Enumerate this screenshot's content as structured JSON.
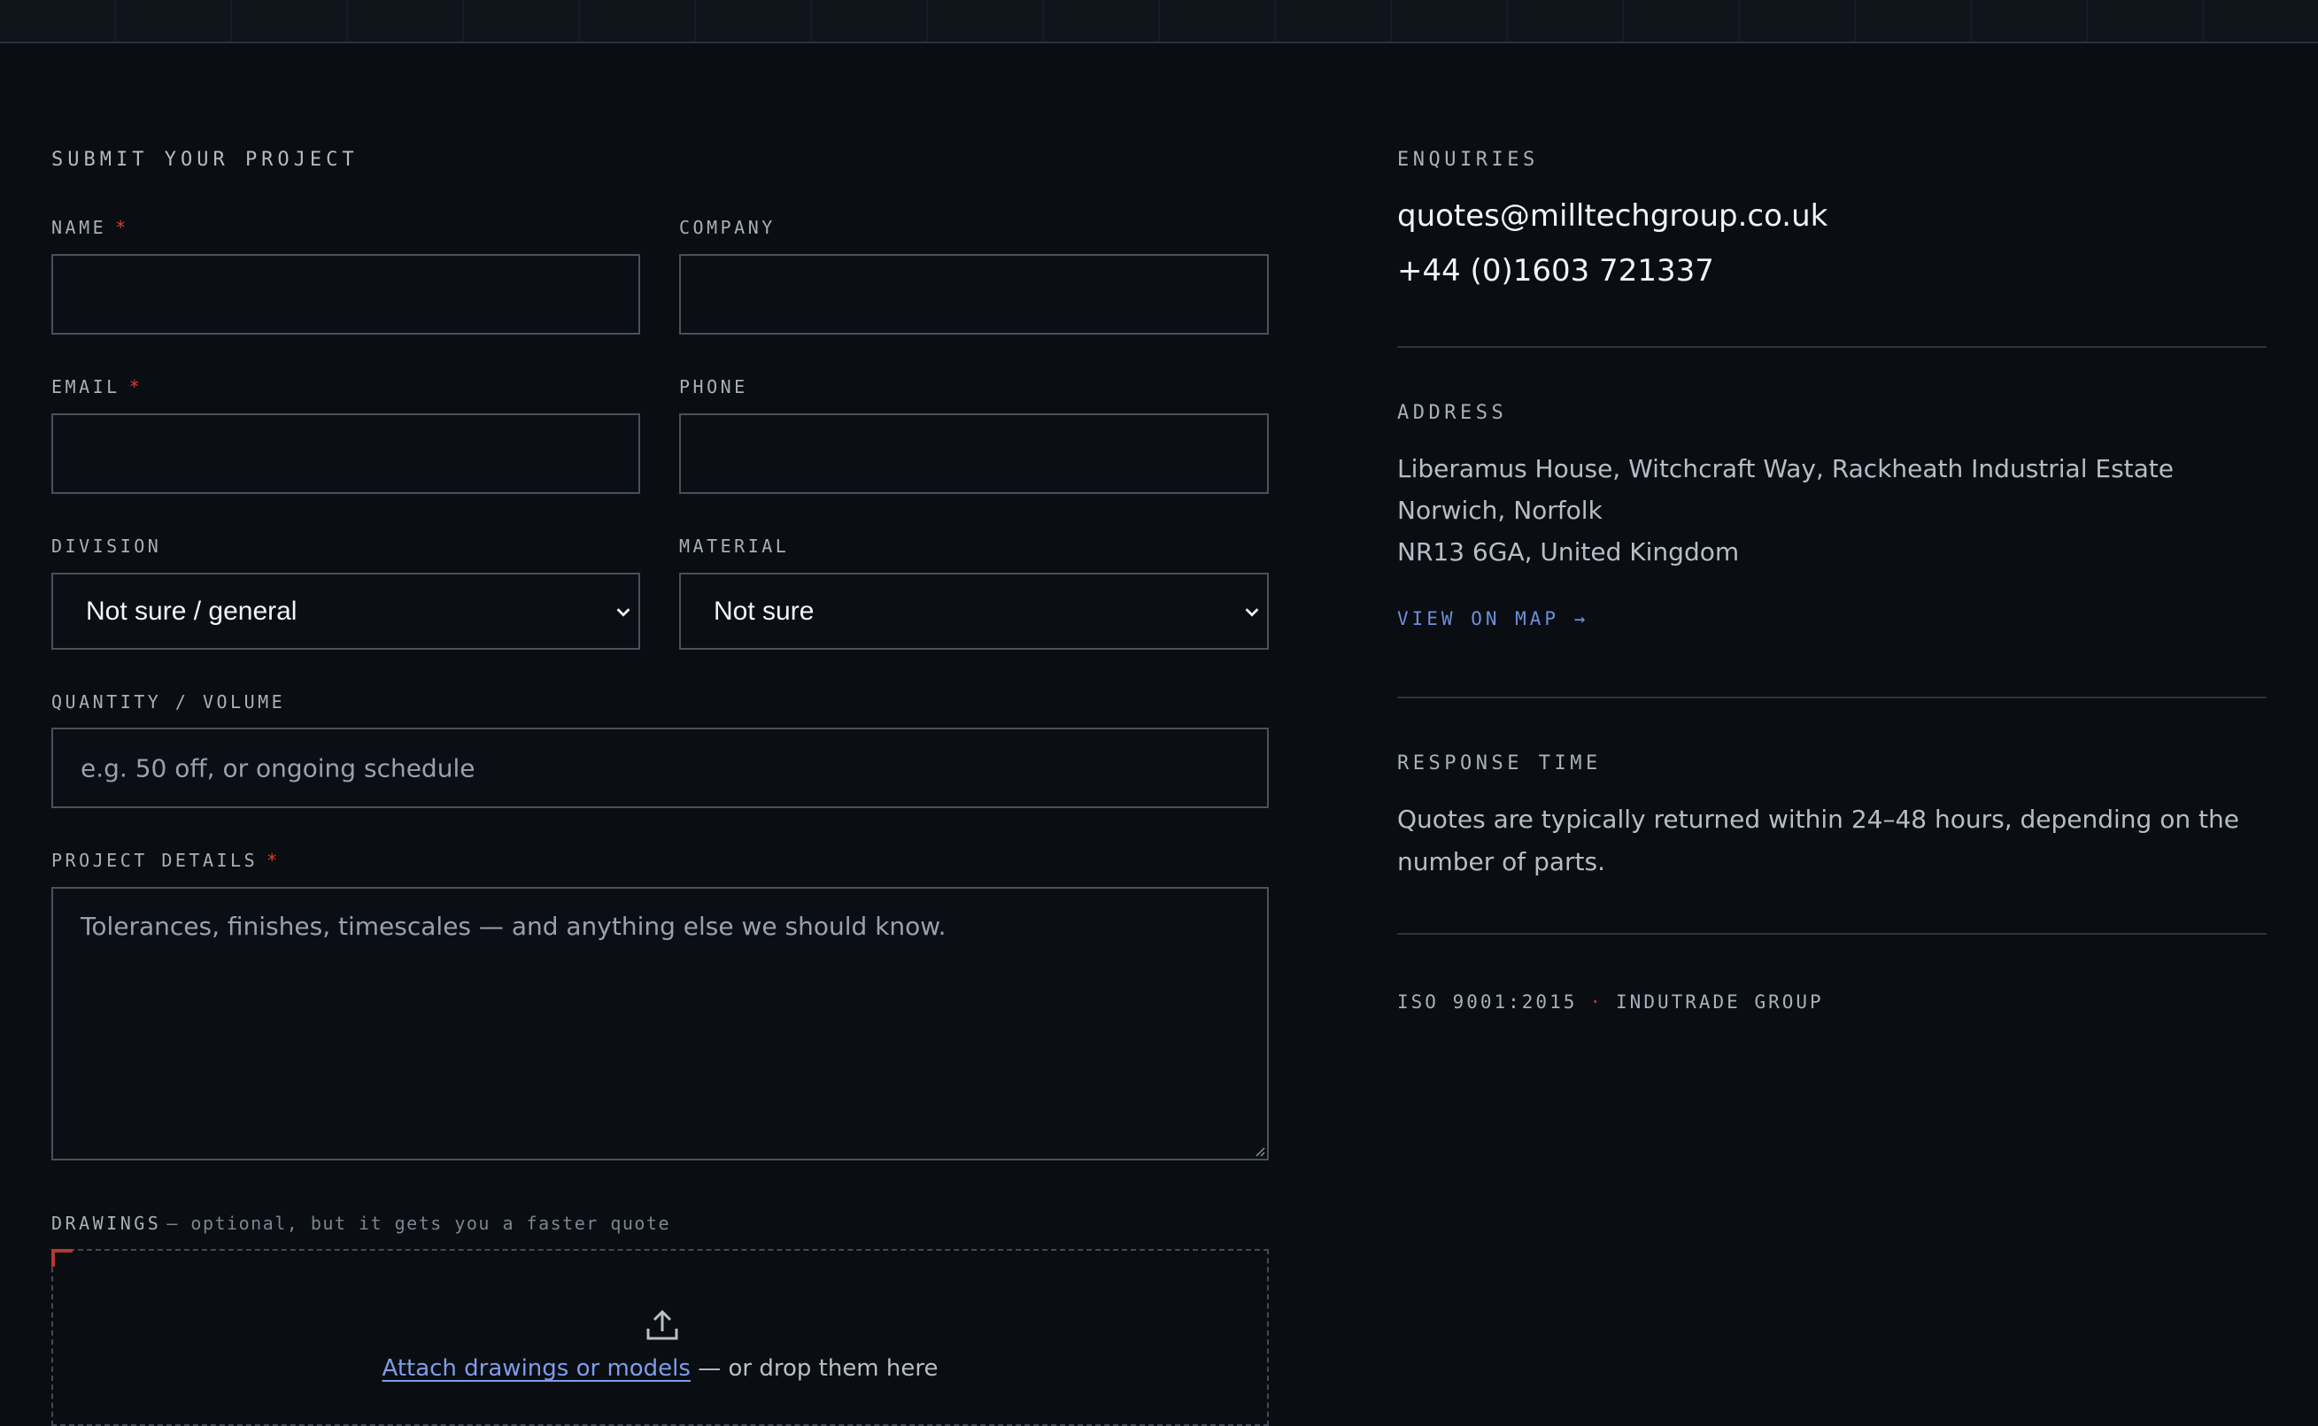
{
  "form": {
    "title": "SUBMIT YOUR PROJECT",
    "required_marker": "*",
    "fields": {
      "name": {
        "label": "NAME",
        "value": ""
      },
      "company": {
        "label": "COMPANY",
        "value": ""
      },
      "email": {
        "label": "EMAIL",
        "value": ""
      },
      "phone": {
        "label": "PHONE",
        "value": ""
      },
      "division": {
        "label": "DIVISION",
        "selected": "Not sure / general"
      },
      "material": {
        "label": "MATERIAL",
        "selected": "Not sure"
      },
      "quantity": {
        "label": "QUANTITY / VOLUME",
        "placeholder": "e.g. 50 off, or ongoing schedule"
      },
      "details": {
        "label": "PROJECT DETAILS",
        "placeholder": "Tolerances, finishes, timescales — and anything else we should know."
      }
    },
    "drawings": {
      "label": "DRAWINGS",
      "note": "— optional, but it gets you a faster quote",
      "link_text": "Attach drawings or models",
      "suffix_text": "— or drop them here",
      "icon": "upload-icon"
    }
  },
  "info": {
    "enquiries": {
      "label": "ENQUIRIES",
      "email": "quotes@milltechgroup.co.uk",
      "phone": "+44 (0)1603 721337"
    },
    "address": {
      "label": "ADDRESS",
      "line1": "Liberamus House, Witchcraft Way, Rackheath Industrial Estate",
      "line2": "Norwich, Norfolk",
      "line3": "NR13 6GA, United Kingdom",
      "map_link": "VIEW ON MAP →"
    },
    "response": {
      "label": "RESPONSE TIME",
      "text": "Quotes are typically returned within 24–48 hours, depending on the number of parts."
    },
    "certifications": {
      "iso": "ISO 9001:2015",
      "separator": "·",
      "group": "INDUTRADE GROUP"
    }
  },
  "colors": {
    "background": "#0a0d12",
    "required": "#d2412f",
    "link": "#7e9ce8",
    "accent_red": "#b33a2c"
  }
}
